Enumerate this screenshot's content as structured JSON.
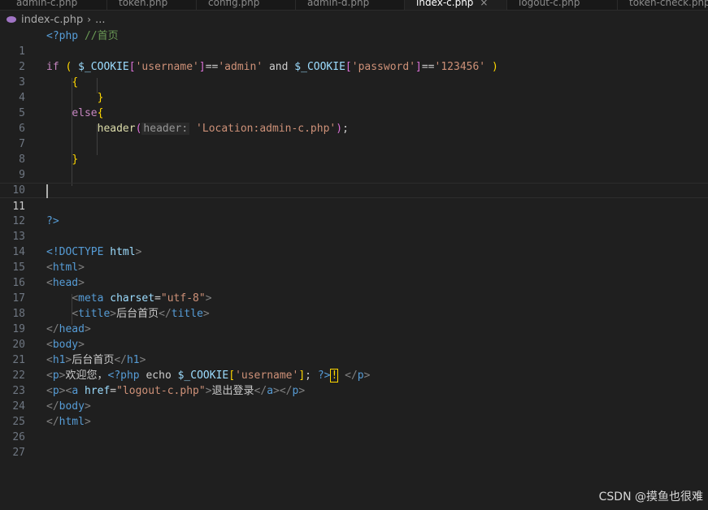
{
  "tabs": [
    {
      "label": "admin-c.php",
      "active": false
    },
    {
      "label": "token.php",
      "active": false
    },
    {
      "label": "config.php",
      "active": false
    },
    {
      "label": "admin-d.php",
      "active": false
    },
    {
      "label": "index-c.php",
      "active": true
    },
    {
      "label": "logout-c.php",
      "active": false
    },
    {
      "label": "token-check.php",
      "active": false
    }
  ],
  "tab_close_glyph": "×",
  "breadcrumb": {
    "file": "index-c.php",
    "chevron": "›",
    "ellipsis": "..."
  },
  "editor": {
    "current_line": 11,
    "line_numbers": [
      "1",
      "2",
      "3",
      "4",
      "5",
      "6",
      "7",
      "8",
      "9",
      "10",
      "11",
      "12",
      "13",
      "14",
      "15",
      "16",
      "17",
      "18",
      "19",
      "20",
      "21",
      "22",
      "23",
      "24",
      "25",
      "26",
      "27"
    ],
    "lines": {
      "l1": {
        "php_open": "<?php",
        "comment": "//首页"
      },
      "l3": {
        "if_kw": "if",
        "p_open": "(",
        "var1": "$_COOKIE",
        "b1_open": "[",
        "str_user": "'username'",
        "b1_close": "]",
        "eq1": "==",
        "str_admin": "'admin'",
        "and_kw": "and",
        "var2": "$_COOKIE",
        "b2_open": "[",
        "str_pass": "'password'",
        "b2_close": "]",
        "eq2": "==",
        "str_num": "'123456'",
        "p_close": ")"
      },
      "l4": {
        "brace": "{"
      },
      "l5": {
        "brace": "}"
      },
      "l6": {
        "else_kw": "else",
        "brace": "{"
      },
      "l7": {
        "fn": "header",
        "p_open": "(",
        "hint": "header:",
        "str": "'Location:admin-c.php'",
        "p_close": ")",
        "semi": ";"
      },
      "l9": {
        "brace": "}"
      },
      "l13": {
        "php_close": "?>"
      },
      "l15": {
        "open": "<!DOCTYPE",
        "name": "html",
        "close": ">"
      },
      "l16": {
        "open": "<",
        "tag": "html",
        "close": ">"
      },
      "l17": {
        "open": "<",
        "tag": "head",
        "close": ">"
      },
      "l18": {
        "open": "<",
        "tag": "meta",
        "attr": "charset",
        "eq": "=",
        "val": "\"utf-8\"",
        "close": ">"
      },
      "l19": {
        "open": "<",
        "tag": "title",
        "close": ">",
        "text": "后台首页",
        "end_open": "</",
        "end_tag": "title",
        "end_close": ">"
      },
      "l20": {
        "open": "</",
        "tag": "head",
        "close": ">"
      },
      "l21": {
        "open": "<",
        "tag": "body",
        "close": ">"
      },
      "l22": {
        "open": "<",
        "tag": "h1",
        "close": ">",
        "text": "后台首页",
        "end_open": "</",
        "end_tag": "h1",
        "end_close": ">"
      },
      "l23": {
        "open": "<",
        "tag": "p",
        "close": ">",
        "text": "欢迎您，",
        "php_open": "<?php",
        "echo_kw": "echo",
        "var": "$_COOKIE",
        "b_open": "[",
        "str": "'username'",
        "b_close": "]",
        "semi": ";",
        "php_close": "?>",
        "mark": "!",
        "end_open": "</",
        "end_tag": "p",
        "end_close": ">"
      },
      "l24": {
        "open1": "<",
        "tag1": "p",
        "close1": ">",
        "open2": "<",
        "tag2": "a",
        "attr": "href",
        "eq": "=",
        "val": "\"logout-c.php\"",
        "close2": ">",
        "text": "退出登录",
        "end_open1": "</",
        "end_tag1": "a",
        "end_close1": ">",
        "end_open2": "</",
        "end_tag2": "p",
        "end_close2": ">"
      },
      "l25": {
        "open": "</",
        "tag": "body",
        "close": ">"
      },
      "l26": {
        "open": "</",
        "tag": "html",
        "close": ">"
      }
    }
  },
  "watermark": "CSDN @摸鱼也很难",
  "colors": {
    "background": "#1f1f1f",
    "keyword": "#c586c0",
    "variable": "#9cdcfe",
    "string": "#ce9178",
    "tag": "#569cd6",
    "comment": "#6a9955",
    "bracket_gold": "#ffd700",
    "bracket_pink": "#da70d6",
    "function": "#dcdcaa"
  }
}
